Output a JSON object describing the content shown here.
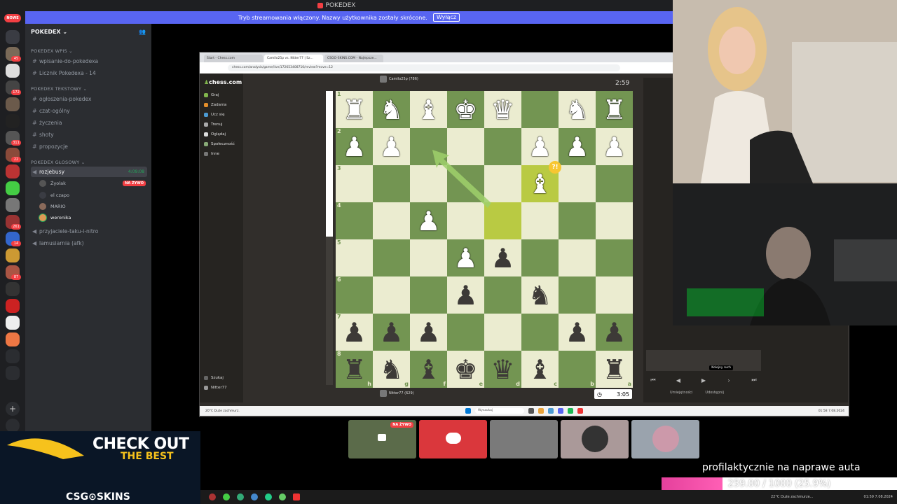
{
  "titlebar": {
    "title": "POKEDEX"
  },
  "streambar": {
    "message": "Tryb streamowania włączony. Nazwy użytkownika zostały skrócone.",
    "button": "Wyłącz"
  },
  "rail": {
    "new_badge": "NOWE",
    "badges": [
      "45",
      "172",
      "311",
      "22",
      "261",
      "14",
      "87"
    ]
  },
  "sidebar": {
    "server_name": "POKEDEX",
    "categories": [
      {
        "label": "POKEDEX Wpis"
      },
      {
        "label": "POKEDEX Tekstowy"
      },
      {
        "label": "POKEDEX GŁOSOWY"
      }
    ],
    "channels_wpis": [
      "wpisanie-do-pokedexa",
      "Licznik Pokedexa - 14"
    ],
    "channels_text": [
      "ogłoszenia-pokedex",
      "czat-ogólny",
      "życzenia",
      "shoty",
      "propozycje"
    ],
    "voice_active": {
      "name": "rozjebusy",
      "timer": "4:09:08"
    },
    "voice_users": [
      {
        "name": "Żyolak",
        "live": "NA ŻYWO"
      },
      {
        "name": "el czapo"
      },
      {
        "name": "MARIO"
      },
      {
        "name": "weronika"
      }
    ],
    "voice_other": [
      "przyjaciele-taku-i-nitro",
      "lamusiarnia (afk)"
    ]
  },
  "browser": {
    "tabs": [
      "Start - Chess.com",
      "Camilo25p vs. Nitter77 | Sz...",
      "CSGO-SKINS.COM - Najlepsze..."
    ],
    "url": "chess.com/analysis/game/live/1726534087​10/review?move=12"
  },
  "chess": {
    "logo": "chess.com",
    "nav": [
      "Graj",
      "Zadania",
      "Ucz się",
      "Trenuj",
      "Oglądaj",
      "Społeczność",
      "Inne"
    ],
    "nav_bottom": [
      "Szukaj",
      "Nitter77"
    ],
    "top_player": "Camilo25p (786)",
    "bottom_player": "Nitter77 (629)",
    "top_clock": "2:59",
    "bottom_clock": "3:05",
    "annotation": "?!",
    "ranks": [
      "1",
      "2",
      "3",
      "4",
      "5",
      "6",
      "7",
      "8"
    ],
    "files": [
      "h",
      "g",
      "f",
      "e",
      "d",
      "c",
      "b",
      "a"
    ],
    "tooltip": "Kolejny ruch",
    "footer": [
      "Umiejętności",
      "Udostępnij"
    ]
  },
  "board_rows": [
    [
      "♜",
      "♞",
      "♝",
      "♚",
      "♛",
      "",
      "♞",
      "♜"
    ],
    [
      "♟",
      "♟",
      "",
      "",
      "",
      "♟",
      "♟",
      "♟"
    ],
    [
      "",
      "",
      "",
      "",
      "",
      "♝",
      "",
      ""
    ],
    [
      "",
      "",
      "♟",
      "",
      "",
      "",
      "",
      ""
    ],
    [
      "",
      "",
      "",
      "♟",
      "♟",
      "",
      "",
      ""
    ],
    [
      "",
      "",
      "",
      "♟",
      "",
      "♞",
      "",
      ""
    ],
    [
      "♟",
      "♟",
      "♟",
      "",
      "",
      "",
      "♟",
      "♟"
    ],
    [
      "♜",
      "♞",
      "♝",
      "♚",
      "♛",
      "♝",
      "",
      "♜"
    ]
  ],
  "board_colors": [
    [
      "w",
      "w",
      "w",
      "w",
      "w",
      "",
      "w",
      "w"
    ],
    [
      "w",
      "w",
      "",
      "",
      "",
      "w",
      "w",
      "w"
    ],
    [
      "",
      "",
      "",
      "",
      "",
      "w",
      "",
      ""
    ],
    [
      "",
      "",
      "w",
      "",
      "",
      "",
      "",
      ""
    ],
    [
      "",
      "",
      "",
      "w",
      "b",
      "",
      "",
      ""
    ],
    [
      "",
      "",
      "",
      "b",
      "",
      "b",
      "",
      ""
    ],
    [
      "b",
      "b",
      "b",
      "",
      "",
      "",
      "b",
      "b"
    ],
    [
      "b",
      "b",
      "b",
      "b",
      "b",
      "b",
      "",
      "b"
    ]
  ],
  "taskbar_inner": {
    "search": "Wyszukaj",
    "weather": "20°C Duże zachmurz.",
    "time": "01:58 7.08.2024"
  },
  "tiles": [
    {
      "live": "NA ŻYWO"
    },
    {},
    {},
    {},
    {}
  ],
  "ad": {
    "line1": "CHECK OUT",
    "line2": "THE BEST",
    "brand": "CSG⊙SKINS"
  },
  "goal": {
    "title": "profilaktycznie na naprawe auta",
    "current": 259.0,
    "target": 1000,
    "text": "259.00 / 1000 (25.9%)",
    "fraction": 0.259
  },
  "outer_taskbar": {
    "weather": "22°C Duże zachmurze...",
    "time": "01:59 7.08.2024"
  },
  "colors": {
    "discord_blurple": "#5865f2",
    "chess_dark": "#739552",
    "chess_light": "#ebecd0",
    "live_red": "#f23f43",
    "goal_pink": "#e5409c"
  }
}
